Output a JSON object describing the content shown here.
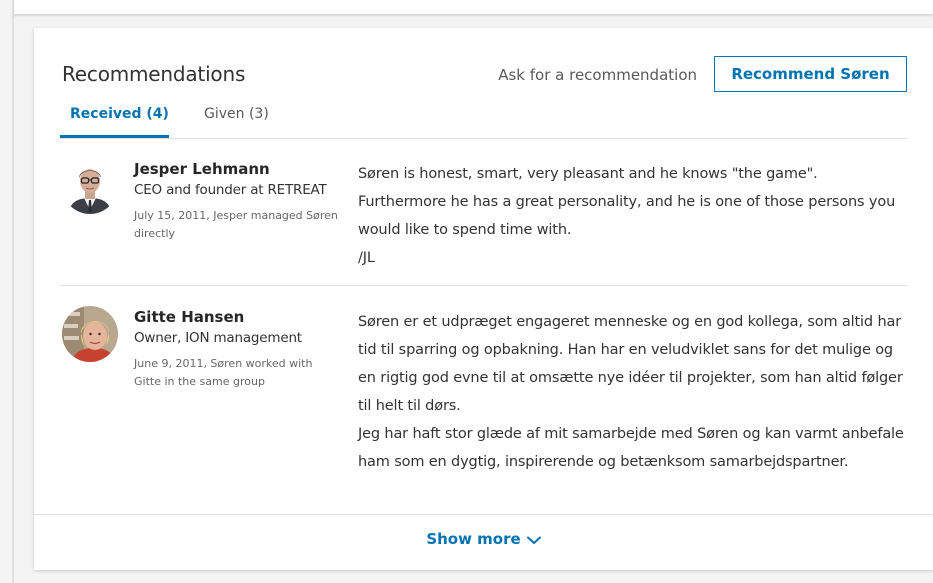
{
  "section": {
    "title": "Recommendations",
    "ask_link": "Ask for a recommendation",
    "recommend_button": "Recommend Søren"
  },
  "tabs": [
    {
      "label": "Received (4)",
      "active": true
    },
    {
      "label": "Given (3)",
      "active": false
    }
  ],
  "recommendations": [
    {
      "name": "Jesper Lehmann",
      "title": "CEO and founder at RETREAT",
      "meta": "July 15, 2011, Jesper managed Søren directly",
      "text": "Søren is honest, smart, very pleasant and he knows \"the game\".\nFurthermore he has a great personality, and he is one of those persons you would like to spend time with.\n/JL"
    },
    {
      "name": "Gitte Hansen",
      "title": "Owner, ION management",
      "meta": "June 9, 2011, Søren worked with Gitte in the same group",
      "text": "Søren er et udpræget engageret menneske og en god kollega, som altid har tid til sparring og opbakning. Han har en veludviklet sans for det mulige og en rigtig god evne til at omsætte nye idéer til projekter, som han altid følger til helt til dørs.\nJeg har haft stor glæde af mit samarbejde med Søren og kan varmt anbefale ham som en dygtig, inspirerende og betænksom samarbejdspartner."
    }
  ],
  "footer": {
    "show_more": "Show more",
    "icon": "chevron-down-icon"
  },
  "colors": {
    "accent": "#0073b1",
    "text": "#333333",
    "muted": "#666666",
    "divider": "#e0e0e0"
  }
}
